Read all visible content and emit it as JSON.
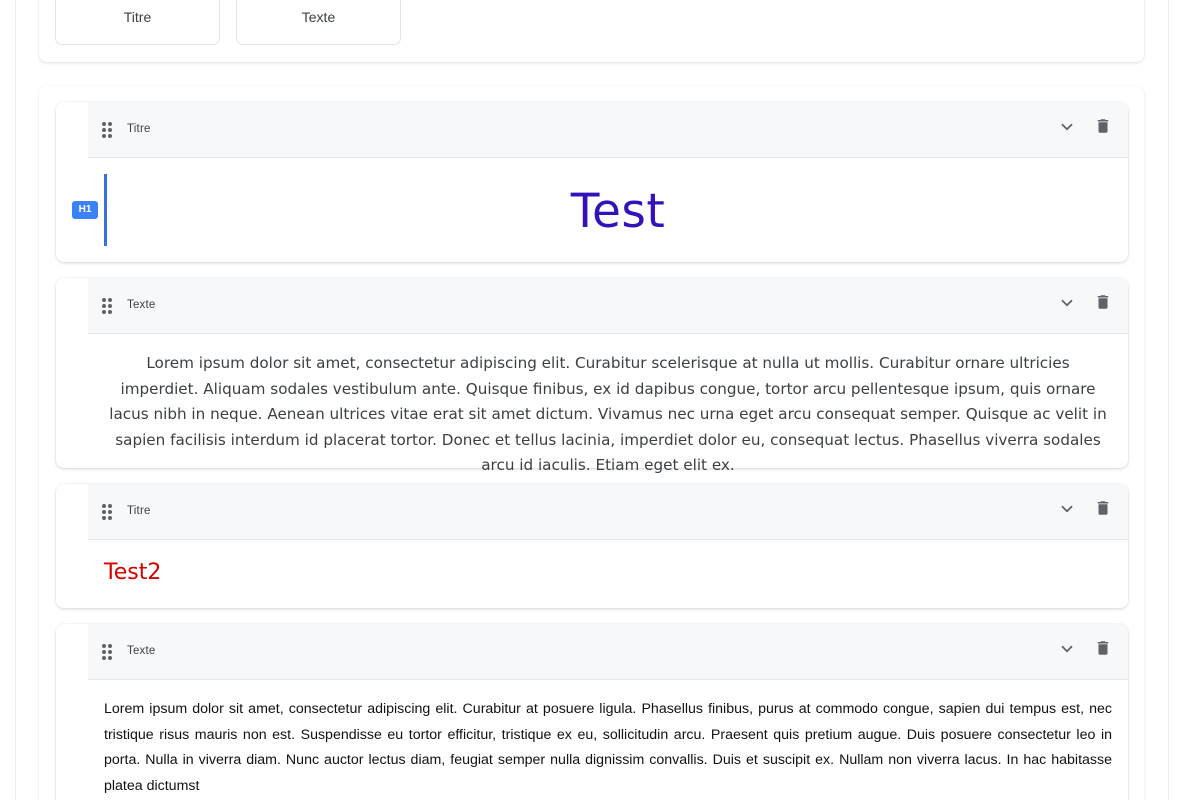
{
  "palette": {
    "buttons": [
      {
        "label": "Titre"
      },
      {
        "label": "Texte"
      }
    ]
  },
  "blocks": [
    {
      "type_label": "Titre",
      "badge": "H1",
      "content": "Test",
      "color": "#3311bb"
    },
    {
      "type_label": "Texte",
      "content": "Lorem ipsum dolor sit amet, consectetur adipiscing elit. Curabitur scelerisque at nulla ut mollis. Curabitur ornare ultricies imperdiet. Aliquam sodales vestibulum ante. Quisque finibus, ex id dapibus congue, tortor arcu pellentesque ipsum, quis ornare lacus nibh in neque. Aenean ultrices vitae erat sit amet dictum. Vivamus nec urna eget arcu consequat semper. Quisque ac velit in sapien facilisis interdum id placerat tortor. Donec et tellus lacinia, imperdiet dolor eu, consequat lectus. Phasellus viverra sodales arcu id iaculis. Etiam eget elit ex."
    },
    {
      "type_label": "Titre",
      "content": "Test2",
      "color": "#d50000"
    },
    {
      "type_label": "Texte",
      "content": "Lorem ipsum dolor sit amet, consectetur adipiscing elit. Curabitur at posuere ligula. Phasellus finibus, purus at commodo congue, sapien dui tempus est, nec tristique risus mauris non est. Suspendisse eu tortor efficitur, tristique ex eu, sollicitudin arcu. Praesent quis pretium augue. Duis posuere consectetur leo in porta. Nulla in viverra diam. Nunc auctor lectus diam, feugiat semper nulla dignissim convallis. Duis et suscipit ex. Nullam non viverra lacus. In hac habitasse platea dictumst"
    }
  ],
  "icons": {
    "drag": "drag-handle-icon",
    "collapse": "chevron-down-icon",
    "delete": "trash-icon"
  },
  "colors": {
    "accent": "#3b82f6",
    "header_bg": "#f7f8fa"
  }
}
